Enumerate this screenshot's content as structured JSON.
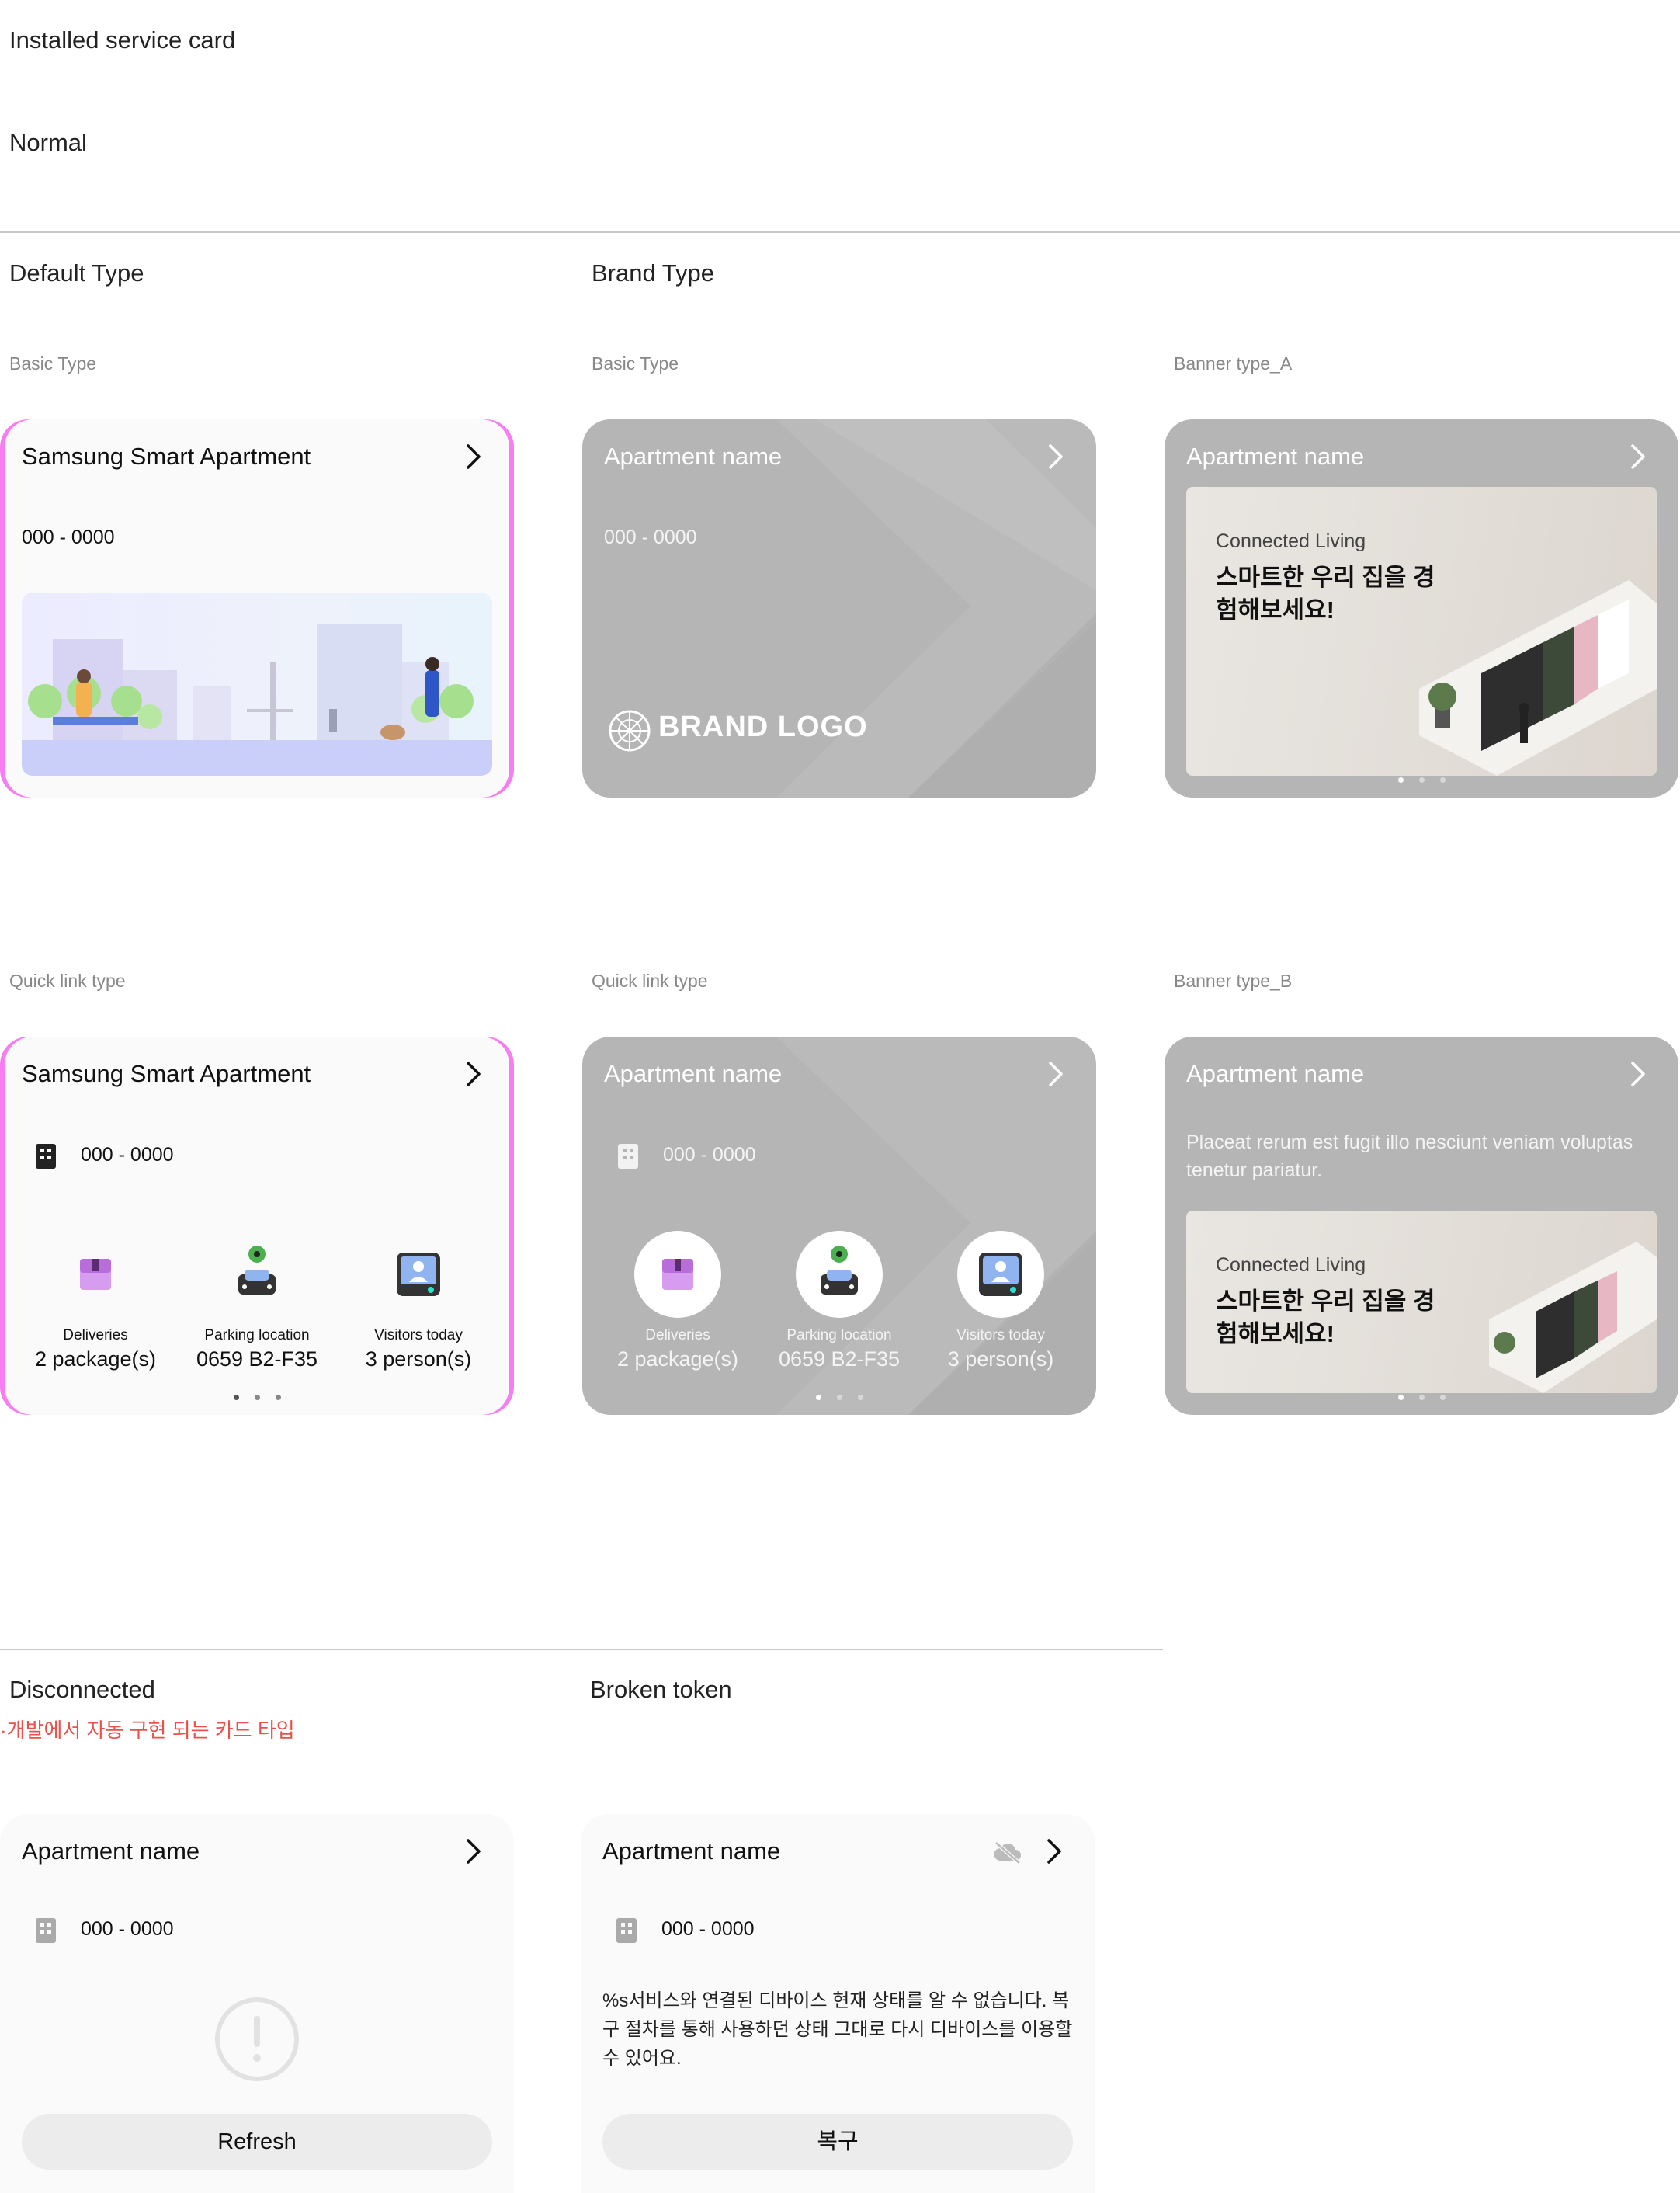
{
  "header": {
    "title": "Installed service card",
    "subtitle": "Normal"
  },
  "sections": {
    "default_type": "Default Type",
    "brand_type": "Brand Type",
    "disconnected": "Disconnected",
    "disconnected_note": "·개발에서 자동 구현 되는 카드 타입",
    "broken_token": "Broken token"
  },
  "labels": {
    "basic_type": "Basic Type",
    "banner_a": "Banner type_A",
    "quick_link": "Quick link type",
    "banner_b": "Banner type_B"
  },
  "cards": {
    "default_basic": {
      "title": "Samsung Smart Apartment",
      "number": "000 - 0000"
    },
    "brand_basic": {
      "title": "Apartment name",
      "number": "000 - 0000",
      "logo_text": "BRAND LOGO"
    },
    "banner_a": {
      "title": "Apartment name",
      "banner_label": "Connected Living",
      "banner_headline": "스마트한 우리 집을 경험해보세요!"
    },
    "default_quick": {
      "title": "Samsung Smart Apartment",
      "number": "000 - 0000",
      "items": [
        {
          "label": "Deliveries",
          "value": "2 package(s)",
          "icon": "package-icon"
        },
        {
          "label": "Parking location",
          "value": "0659 B2-F35",
          "icon": "car-icon"
        },
        {
          "label": "Visitors today",
          "value": "3 person(s)",
          "icon": "visitor-icon"
        }
      ]
    },
    "brand_quick": {
      "title": "Apartment name",
      "number": "000 - 0000",
      "items": [
        {
          "label": "Deliveries",
          "value": "2 package(s)",
          "icon": "package-icon"
        },
        {
          "label": "Parking location",
          "value": "0659 B2-F35",
          "icon": "car-icon"
        },
        {
          "label": "Visitors today",
          "value": "3 person(s)",
          "icon": "visitor-icon"
        }
      ]
    },
    "banner_b": {
      "title": "Apartment name",
      "description": "Placeat rerum est fugit illo nesciunt veniam voluptas tenetur pariatur.",
      "banner_label": "Connected Living",
      "banner_headline": "스마트한 우리 집을 경험해보세요!"
    },
    "disconnected": {
      "title": "Apartment name",
      "number": "000 - 0000",
      "button": "Refresh"
    },
    "broken": {
      "title": "Apartment name",
      "number": "000 - 0000",
      "message": "%s서비스와 연결된 디바이스 현재 상태를 알 수 없습니다. 복구 절차를 통해 사용하던 상태 그대로 다시 디바이스를 이용할 수 있어요.",
      "button": "복구"
    }
  },
  "colors": {
    "warning": "#e8514c",
    "brand_card": "#b5b5b5",
    "accent_edge": "#f77ef2"
  }
}
